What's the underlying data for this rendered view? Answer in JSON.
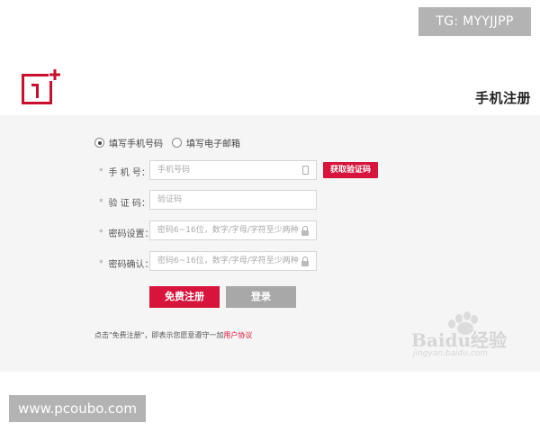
{
  "watermarks": {
    "top_right": "TG: MYYJJPP",
    "bottom_left": "www.pcoubo.com",
    "baidu_text": "Baidu经验",
    "baidu_url": "jingyan.baidu.com"
  },
  "header": {
    "brand_logo": "1+",
    "page_title": "手机注册"
  },
  "form": {
    "register_method": {
      "options": [
        {
          "label": "填写手机号码",
          "selected": true
        },
        {
          "label": "填写电子邮箱",
          "selected": false
        }
      ]
    },
    "fields": {
      "phone": {
        "label": "手 机 号：",
        "placeholder": "手机号码",
        "icon": "phone-icon"
      },
      "code": {
        "label": "验 证 码：",
        "placeholder": "验证码"
      },
      "password": {
        "label": "密码设置：",
        "placeholder": "密码6~16位，数字/字母/字符至少两种",
        "icon": "lock-icon"
      },
      "password_confirm": {
        "label": "密码确认：",
        "placeholder": "密码6~16位，数字/字母/字符至少两种",
        "icon": "lock-icon"
      }
    },
    "required_mark": "*",
    "get_code_label": "获取验证码",
    "register_label": "免费注册",
    "login_label": "登录"
  },
  "agreement": {
    "prefix": "点击\"免费注册\"，即表示您愿意遵守一加",
    "link": "用户协议"
  },
  "colors": {
    "accent": "#d7143c",
    "secondary_button": "#a8a8a8",
    "panel_background": "#f5f5f5"
  }
}
